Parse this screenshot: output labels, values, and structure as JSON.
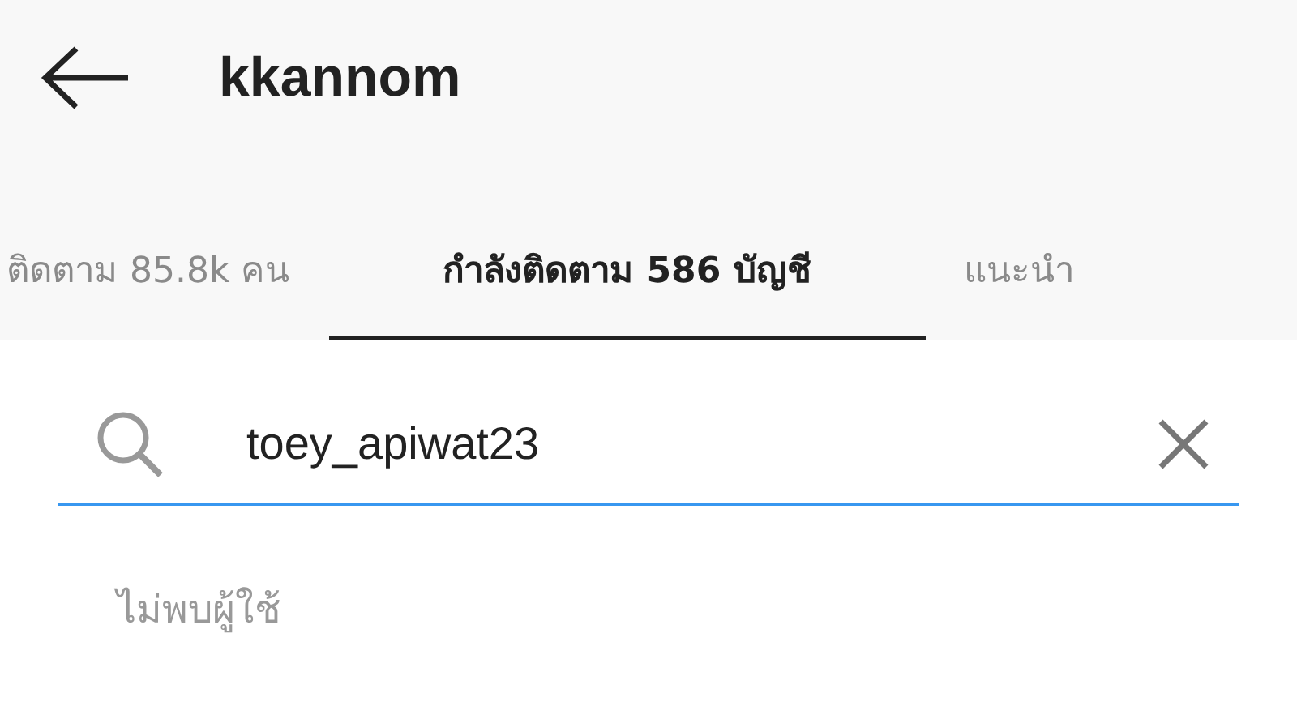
{
  "header": {
    "title": "kkannom"
  },
  "tabs": [
    {
      "label": "ติดตาม 85.8k คน",
      "selected": false
    },
    {
      "label": "กำลังติดตาม 586 บัญชี",
      "selected": true
    },
    {
      "label": "แนะนำ",
      "selected": false
    }
  ],
  "search": {
    "value": "toey_apiwat23"
  },
  "message": "ไม่พบผู้ใช้"
}
